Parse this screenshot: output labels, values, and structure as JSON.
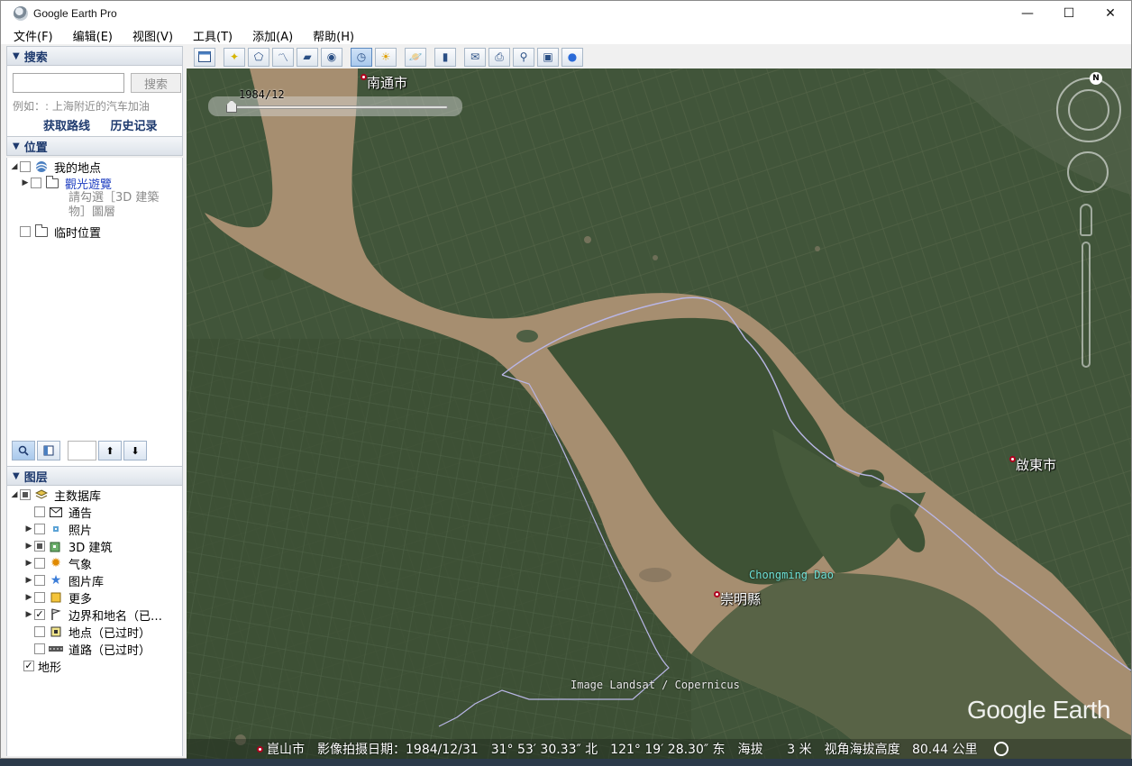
{
  "window": {
    "title": "Google Earth Pro",
    "controls": [
      "—",
      "☐",
      "✕"
    ]
  },
  "menu": [
    "文件(F)",
    "编辑(E)",
    "视图(V)",
    "工具(T)",
    "添加(A)",
    "帮助(H)"
  ],
  "search": {
    "header": "搜索",
    "input_value": "",
    "button": "搜索",
    "hint": "例如：: 上海附近的汽车加油",
    "links": [
      "获取路线",
      "历史记录"
    ]
  },
  "places": {
    "header": "位置",
    "items": [
      {
        "label": "我的地点",
        "icon": "globe-icon"
      },
      {
        "label": "觀光遊覽",
        "icon": "folder-icon"
      },
      {
        "label": "請勾選［3D 建築物］圖層",
        "icon": ""
      },
      {
        "label": "临时位置",
        "icon": "folder-icon"
      }
    ]
  },
  "layers": {
    "header": "图层",
    "items": [
      {
        "label": "主数据库",
        "icon": "layers-icon",
        "state": "partial"
      },
      {
        "label": "通告",
        "icon": "mail-icon",
        "state": "unchecked"
      },
      {
        "label": "照片",
        "icon": "photo-icon",
        "state": "unchecked"
      },
      {
        "label": "3D 建筑",
        "icon": "building-icon",
        "state": "partial"
      },
      {
        "label": "气象",
        "icon": "sun-icon",
        "state": "unchecked"
      },
      {
        "label": "图片库",
        "icon": "star-icon",
        "state": "unchecked"
      },
      {
        "label": "更多",
        "icon": "note-icon",
        "state": "unchecked"
      },
      {
        "label": "边界和地名（已…",
        "icon": "flag-icon",
        "state": "checked"
      },
      {
        "label": "地点（已过时）",
        "icon": "place-icon",
        "state": "unchecked"
      },
      {
        "label": "道路（已过时）",
        "icon": "road-icon",
        "state": "unchecked"
      },
      {
        "label": "地形",
        "icon": "",
        "state": "checked"
      }
    ]
  },
  "map": {
    "time_slider_label": "1984/12",
    "labels": {
      "nantong": "南通市",
      "qidong": "啟東市",
      "chongming_county": "崇明縣",
      "chongming_dao": "Chongming Dao",
      "kunshan": "崑山市",
      "credit": "Image Landsat / Copernicus"
    },
    "north": "N",
    "logo": "Google Earth"
  },
  "status": {
    "imagery_date": "影像拍摄日期：1984/12/31",
    "lat": "31° 53′ 30.33″ 北",
    "lon": "121° 19′ 28.30″ 东",
    "elevation": "海拔      3 米",
    "eye_alt": "视角海拔高度   80.44 公里"
  },
  "colors": {
    "river": "#a89072",
    "land": "#3e5235",
    "accent": "#1e3a6e",
    "border_line": "#b9b6e6"
  }
}
